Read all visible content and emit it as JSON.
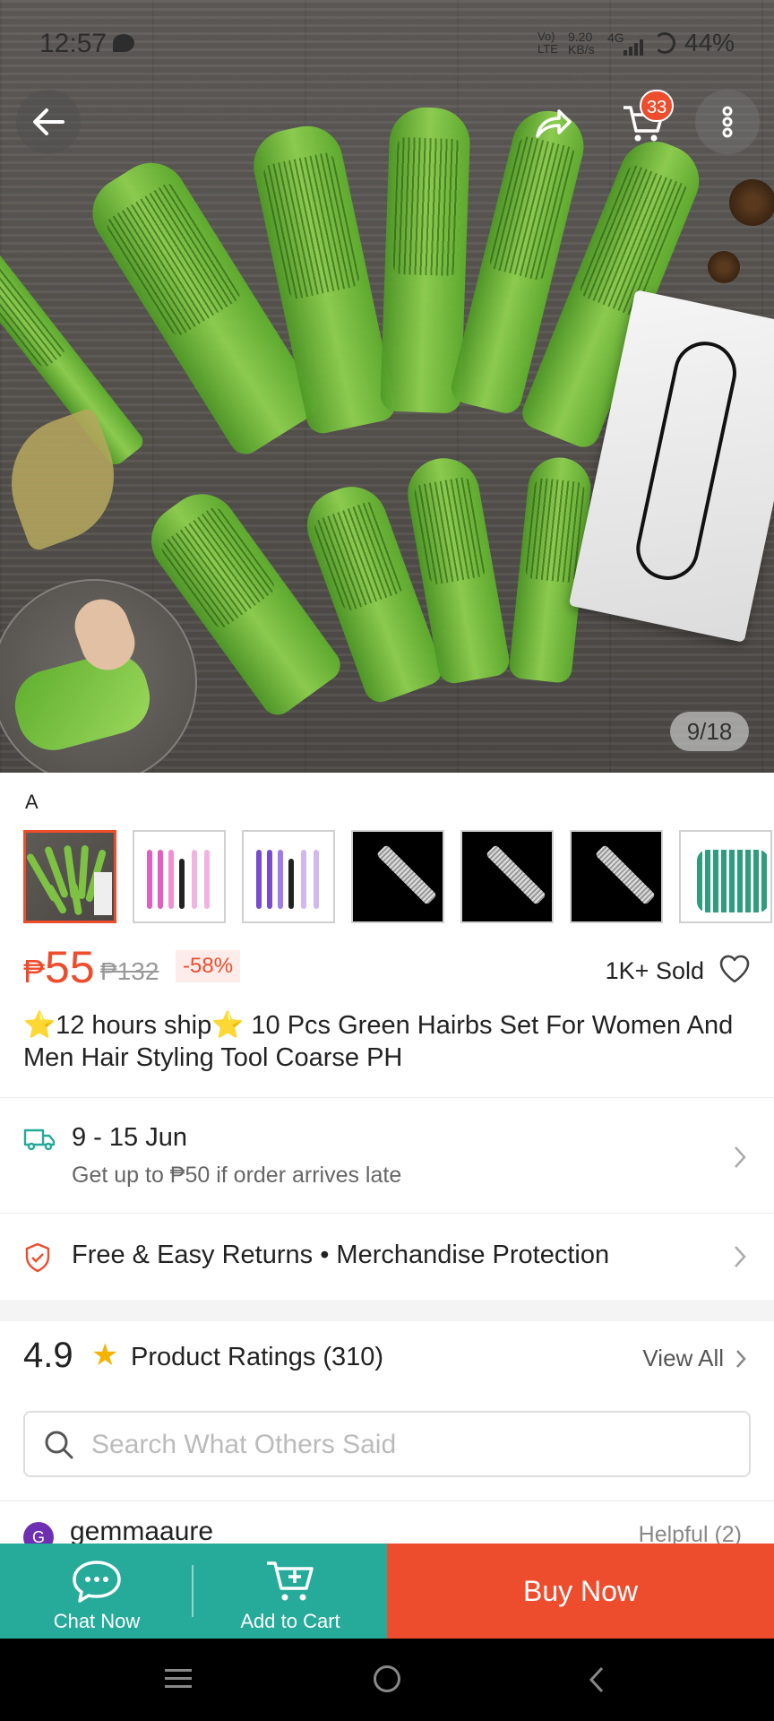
{
  "status_bar": {
    "time": "12:57",
    "network_top": "Vo)",
    "network_bottom": "LTE",
    "speed_top": "9.20",
    "speed_bottom": "KB/s",
    "gen": "4G",
    "battery": "44%"
  },
  "header": {
    "cart_count": "33"
  },
  "gallery": {
    "counter": "9/18"
  },
  "variant": {
    "label": "A"
  },
  "price": {
    "currency": "₱",
    "current": "55",
    "original": "₱132",
    "discount": "-58%",
    "sold": "1K+ Sold"
  },
  "product": {
    "title_star": "⭐",
    "title": "12 hours ship⭐ 10 Pcs Green Hairbs Set For Women And Men Hair Styling Tool Coarse PH"
  },
  "shipping": {
    "date": "9 - 15 Jun",
    "guarantee": "Get up to ₱50 if order arrives late"
  },
  "returns": {
    "text": "Free & Easy Returns  •  Merchandise Protection"
  },
  "ratings": {
    "score": "4.9",
    "label": "Product Ratings (310)",
    "view_all": "View All"
  },
  "review_search": {
    "placeholder": "Search What Others Said"
  },
  "review_preview": {
    "avatar_letter": "G",
    "username": "gemmaaure",
    "helpful": "Helpful (2)"
  },
  "action_bar": {
    "chat_label": "Chat Now",
    "cart_label": "Add to Cart",
    "buy_label": "Buy Now"
  },
  "colors": {
    "brand": "#ee4d2d",
    "teal": "#26aa99",
    "star": "#f5b301"
  }
}
